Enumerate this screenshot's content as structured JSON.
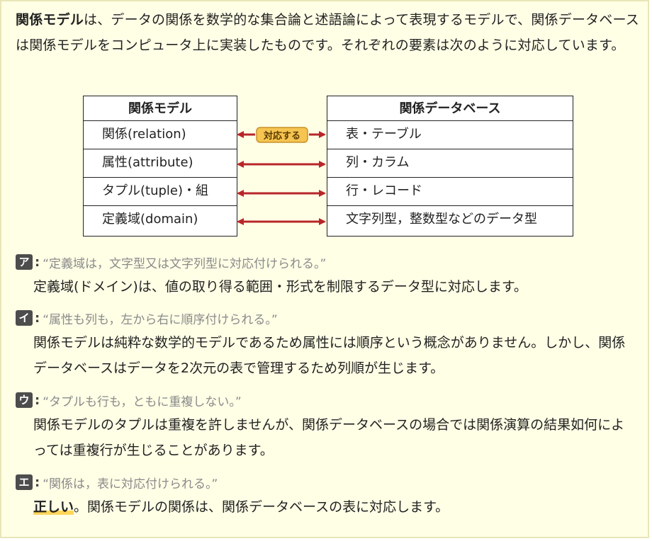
{
  "intro": {
    "bold": "関係モデル",
    "text": "は、データの関係を数学的な集合論と述語論によって表現するモデルで、関係データベースは関係モデルをコンピュータ上に実装したものです。それぞれの要素は次のように対応しています。"
  },
  "diagram": {
    "left_header": "関係モデル",
    "right_header": "関係データベース",
    "left_rows": [
      "関係(relation)",
      "属性(attribute)",
      "タプル(tuple)・組",
      "定義域(domain)"
    ],
    "right_rows": [
      "表・テーブル",
      "列・カラム",
      "行・レコード",
      "文字列型，整数型などのデータ型"
    ],
    "arrow_label": "対応する",
    "arrow_color": "#b8262a",
    "label_bg": "#f5c451"
  },
  "options": [
    {
      "badge": "ア",
      "quote": "“定義域は，文字型又は文字列型に対応付けられる。”",
      "explanation": "定義域(ドメイン)は、値の取り得る範囲・形式を制限するデータ型に対応します。"
    },
    {
      "badge": "イ",
      "quote": "“属性も列も，左から右に順序付けられる。”",
      "explanation": "関係モデルは純粋な数学的モデルであるため属性には順序という概念がありません。しかし、関係データベースはデータを2次元の表で管理するため列順が生じます。"
    },
    {
      "badge": "ウ",
      "quote": "“タプルも行も，ともに重複しない。”",
      "explanation": "関係モデルのタプルは重複を許しませんが、関係データベースの場合では関係演算の結果如何によっては重複行が生じることがあります。"
    },
    {
      "badge": "エ",
      "quote": "“関係は，表に対応付けられる。”",
      "correct_label": "正しい",
      "explanation": "。関係モデルの関係は、関係データベースの表に対応します。"
    }
  ]
}
